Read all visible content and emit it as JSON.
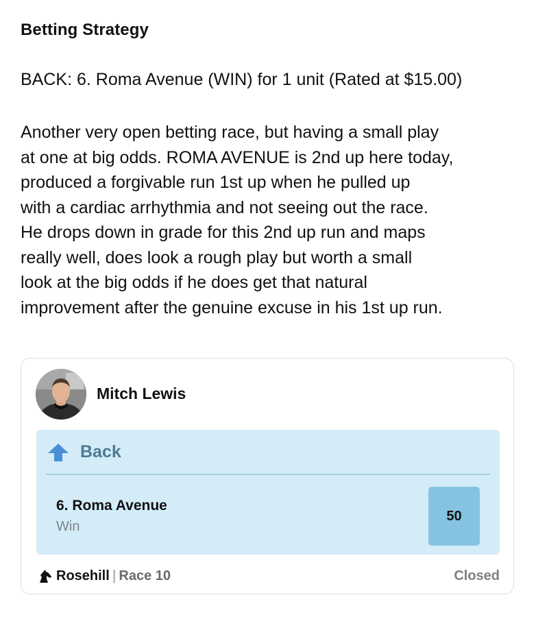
{
  "post": {
    "heading": "Betting Strategy",
    "back_line": "BACK: 6. Roma Avenue (WIN) for 1 unit (Rated at $15.00)",
    "analysis_lines": [
      "Another very open betting race, but having a small play",
      "at one at big odds. ROMA AVENUE is 2nd up here today,",
      "produced a forgivable run 1st up when he pulled up",
      "with a cardiac arrhythmia and not seeing out the race.",
      "He drops down in grade for this 2nd up run and maps",
      "really well, does look a rough play but worth a small",
      "look at the big odds if he does get that natural",
      "improvement after the genuine excuse in his 1st up run."
    ]
  },
  "card": {
    "tipster_name": "Mitch Lewis",
    "avatar_icon": "person-photo",
    "bet_direction": "Back",
    "bet_direction_icon": "arrow-up-icon",
    "accent_color": "#4a90d9",
    "selection": "6. Roma Avenue",
    "bet_type": "Win",
    "odds": "50",
    "venue_icon": "horse-head-icon",
    "venue": "Rosehill",
    "separator": "|",
    "race": "Race 10",
    "status": "Closed"
  }
}
